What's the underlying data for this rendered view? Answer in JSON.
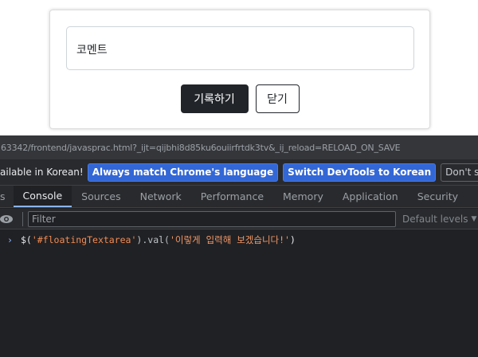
{
  "page": {
    "comment_label": "코멘트",
    "record_button": "기록하기",
    "close_button": "닫기"
  },
  "devtools": {
    "url": "63342/frontend/javasprac.html?_ijt=qijbhi8d85ku6ouiirfrtdk3tv&_ij_reload=RELOAD_ON_SAVE",
    "lang_message": "ailable in Korean!",
    "lang_buttons": {
      "match": "Always match Chrome's language",
      "switch": "Switch DevTools to Korean",
      "dont_show": "Don't show again"
    },
    "tabs": [
      "s",
      "Console",
      "Sources",
      "Network",
      "Performance",
      "Memory",
      "Application",
      "Security"
    ],
    "more_tabs": "»",
    "filter_placeholder": "Filter",
    "levels_label": "Default levels",
    "levels_arrow": "▼",
    "console": {
      "prompt": "›",
      "code_prefix": "$(",
      "selector": "'#floatingTextarea'",
      "code_mid": ").val(",
      "argument": "'이렇게 입력해 보겠습니다!'",
      "code_suffix": ")"
    }
  }
}
